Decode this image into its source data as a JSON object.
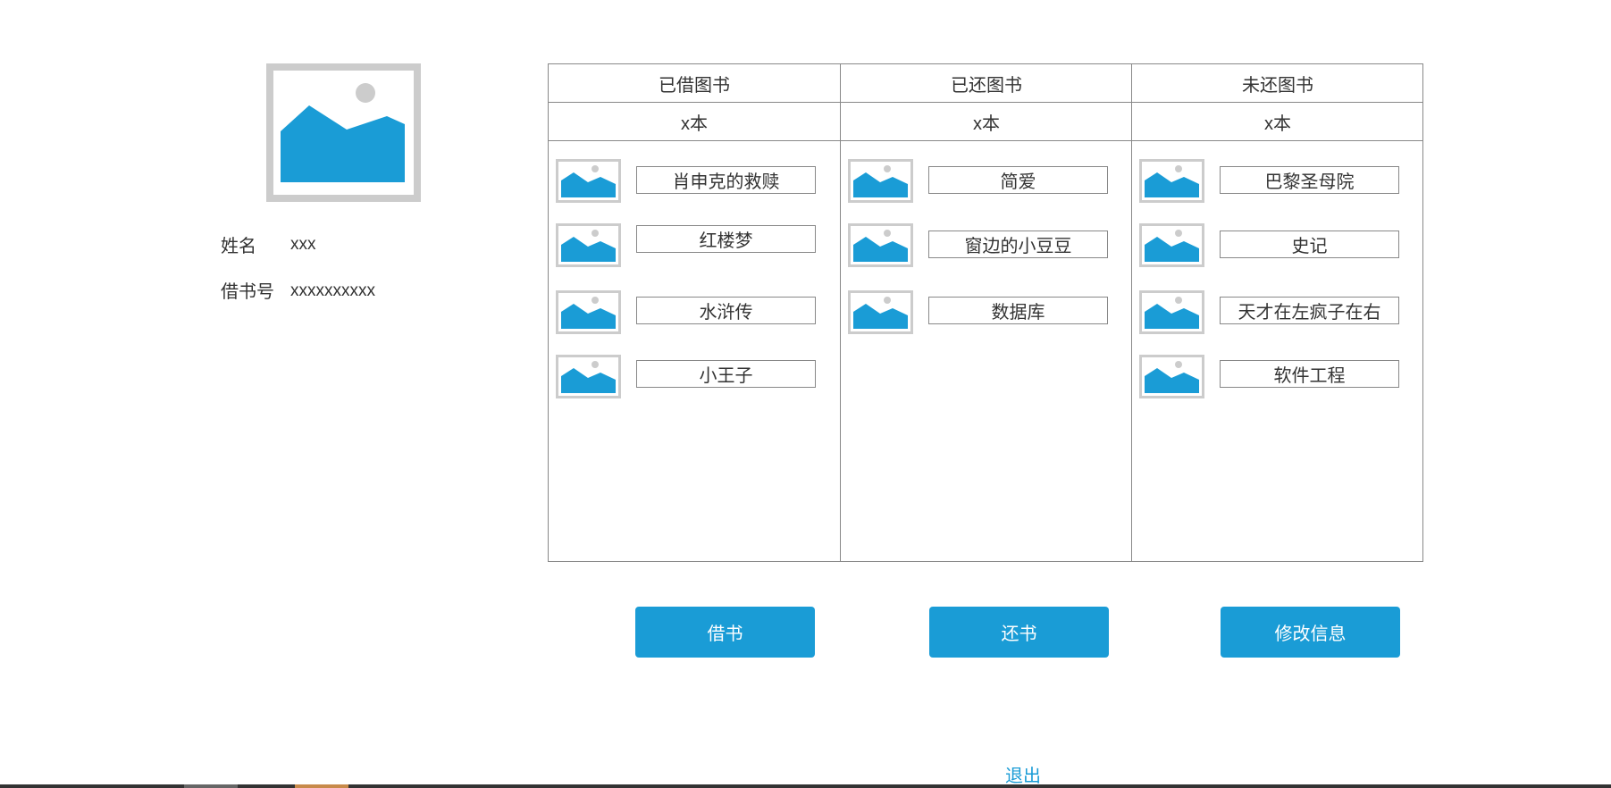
{
  "profile": {
    "name_label": "姓名",
    "name_value": "xxx",
    "card_label": "借书号",
    "card_value": "xxxxxxxxxx"
  },
  "columns": [
    {
      "title": "已借图书",
      "count": "x本",
      "books": [
        "肖申克的救赎",
        "红楼梦",
        "水浒传",
        "小王子"
      ]
    },
    {
      "title": "已还图书",
      "count": "x本",
      "books": [
        "简爱",
        "窗边的小豆豆",
        "数据库"
      ]
    },
    {
      "title": "未还图书",
      "count": "x本",
      "books": [
        "巴黎圣母院",
        "史记",
        "天才在左疯子在右",
        "软件工程"
      ]
    }
  ],
  "actions": {
    "borrow": "借书",
    "return": "还书",
    "edit": "修改信息"
  },
  "logout": "退出",
  "colors": {
    "accent": "#1a9cd6",
    "border": "#888888",
    "placeholder": "#cccccc"
  }
}
